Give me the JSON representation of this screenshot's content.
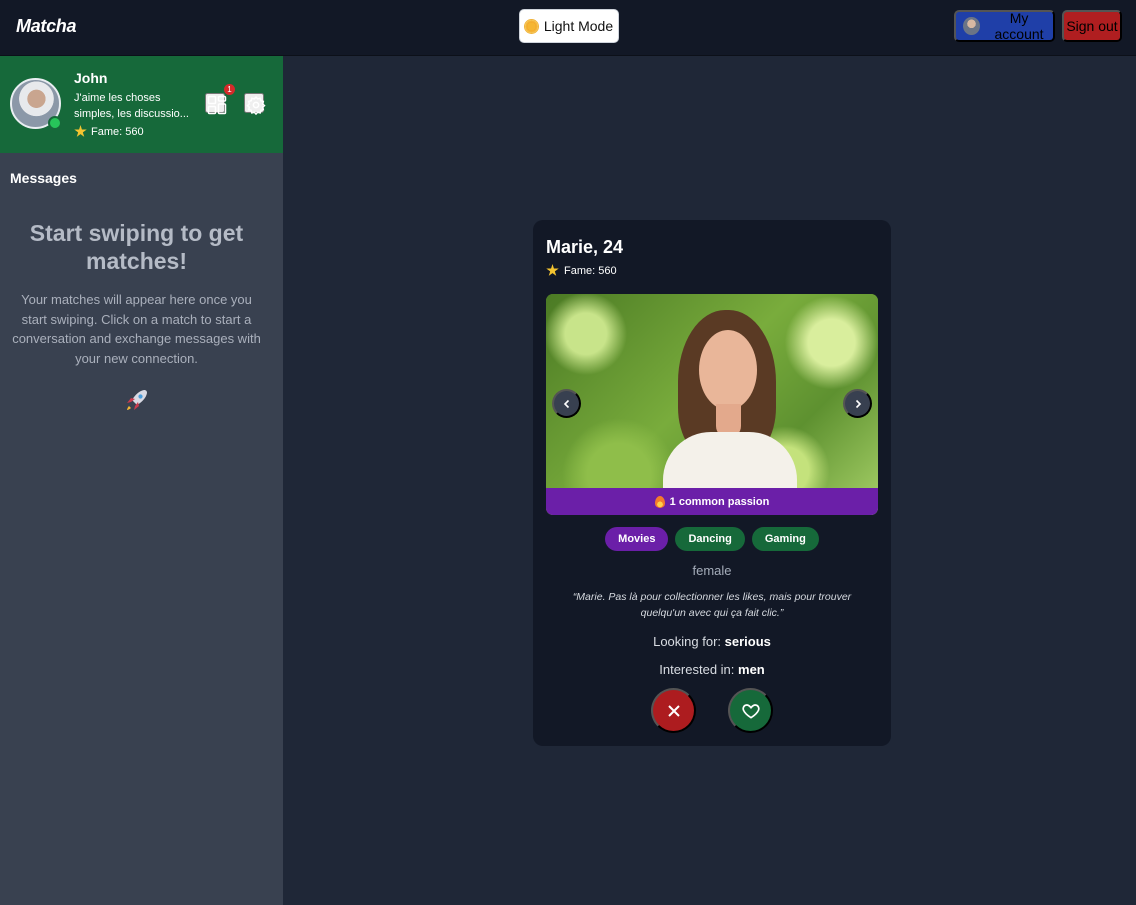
{
  "header": {
    "brand": "Matcha",
    "mode_label": "Light Mode",
    "account_label": "My account",
    "signout_label": "Sign out"
  },
  "sidebar": {
    "user": {
      "name": "John",
      "bio": "J'aime les choses simples, les discussio...",
      "fame_label": "Fame: 560",
      "online": true,
      "notifications": "1"
    },
    "messages_title": "Messages",
    "empty_title": "Start swiping to get matches!",
    "empty_text": "Your matches will appear here once you start swiping. Click on a match to start a conversation and exchange messages with your new connection.",
    "empty_icon": "rocket-icon"
  },
  "profile_card": {
    "name_age": "Marie, 24",
    "fame_label": "Fame: 560",
    "common_passions": "1 common passion",
    "tags": [
      {
        "label": "Movies",
        "common": true
      },
      {
        "label": "Dancing",
        "common": false
      },
      {
        "label": "Gaming",
        "common": false
      }
    ],
    "gender": "female",
    "quote": "“Marie. Pas là pour collectionner les likes, mais pour trouver quelqu'un avec qui ça fait clic.”",
    "looking_for_label": "Looking for:",
    "looking_for_value": "serious",
    "interested_in_label": "Interested in:",
    "interested_in_value": "men"
  },
  "colors": {
    "accent_green": "#16693a",
    "accent_purple": "#6b1fa8",
    "danger_red": "#ad1c1f",
    "primary_blue": "#1f3fa8",
    "background": "#1f2737",
    "panel": "#121826"
  }
}
